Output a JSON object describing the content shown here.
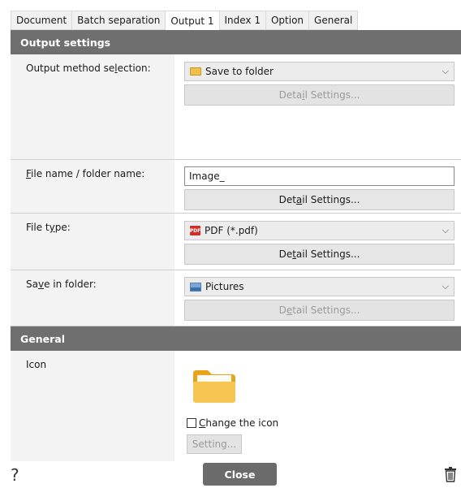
{
  "tabs": [
    {
      "label": "Document"
    },
    {
      "label": "Batch separation"
    },
    {
      "label": "Output 1"
    },
    {
      "label": "Index 1"
    },
    {
      "label": "Option"
    },
    {
      "label": "General"
    }
  ],
  "active_tab": "Output 1",
  "output_settings": {
    "header": "Output settings",
    "method": {
      "label": "Output method selection:",
      "value": "Save to folder",
      "value_icon": "folder-icon",
      "detail_button": "Detail Settings..."
    },
    "file_name": {
      "label": "File name / folder name:",
      "value": "Image_",
      "detail_button": "Detail Settings..."
    },
    "file_type": {
      "label": "File type:",
      "value": "PDF (*.pdf)",
      "value_icon": "pdf-icon",
      "detail_button": "Detail Settings..."
    },
    "save_in_folder": {
      "label": "Save in folder:",
      "value": "Pictures",
      "value_icon": "pictures-icon",
      "detail_button": "Detail Settings..."
    }
  },
  "general": {
    "header": "General",
    "icon_label": "Icon",
    "change_icon_label": "Change the icon",
    "change_icon_checked": false,
    "setting_button": "Setting..."
  },
  "bottom": {
    "help": "?",
    "close_button": "Close"
  },
  "colors": {
    "section_header": "#6f6f6f",
    "close_button": "#6b6b6b",
    "label_panel": "#f3f3f3"
  }
}
